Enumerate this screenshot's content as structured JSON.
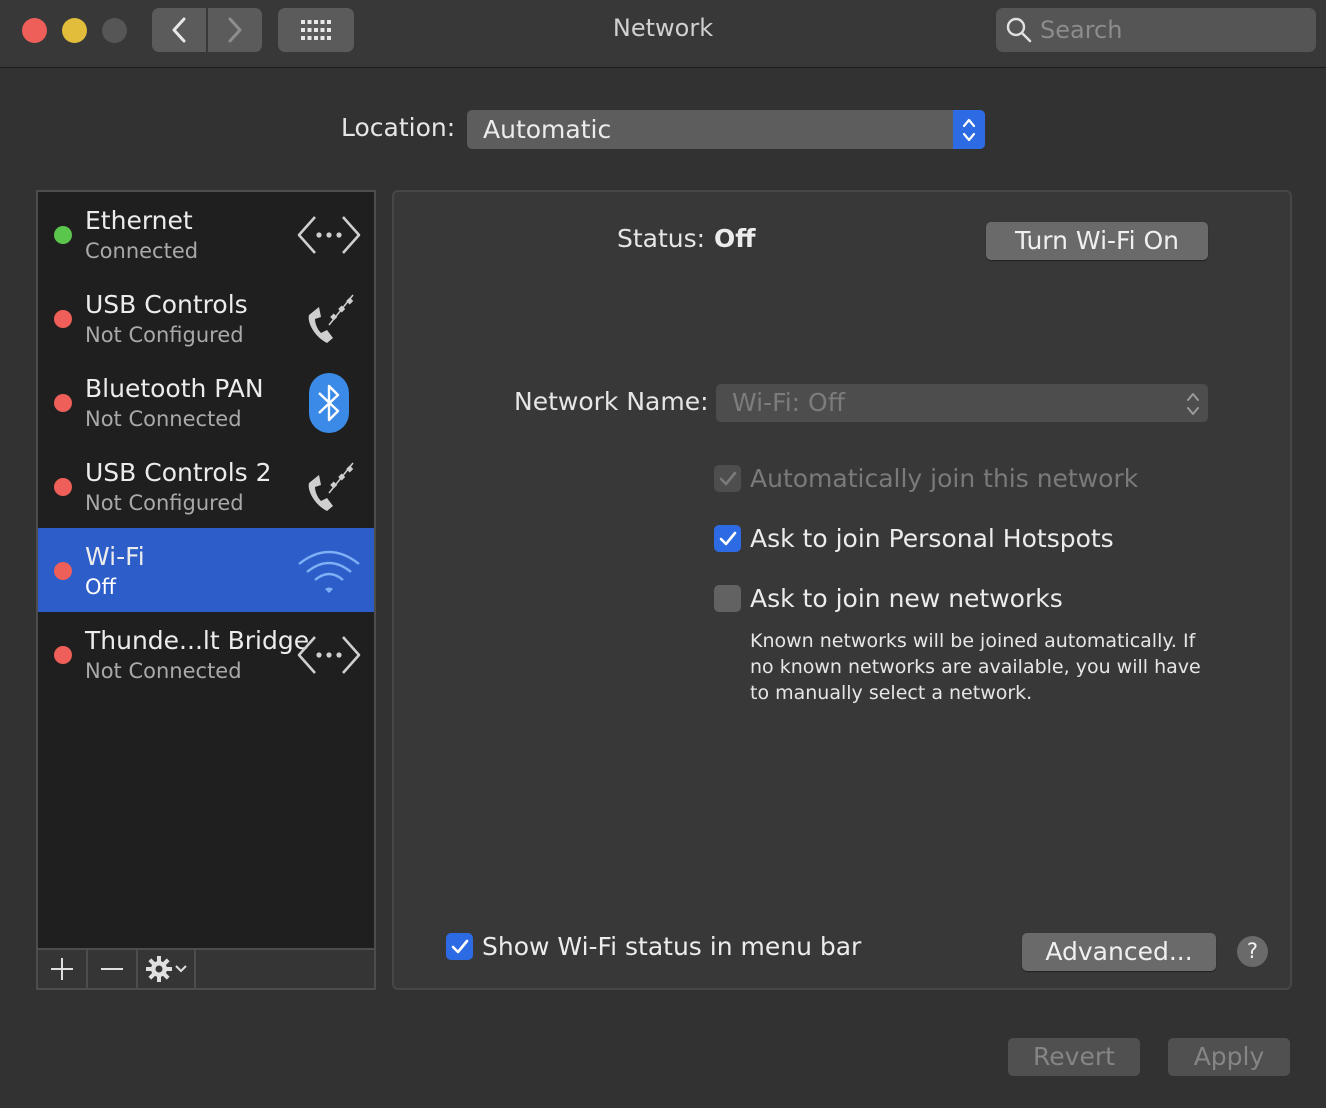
{
  "window": {
    "title": "Network",
    "search_placeholder": "Search"
  },
  "location": {
    "label": "Location:",
    "value": "Automatic"
  },
  "services": [
    {
      "name": "Ethernet",
      "status": "Connected",
      "dot_color": "#5bc64c",
      "icon": "ethernet-arrows-icon"
    },
    {
      "name": "USB Controls",
      "status": "Not Configured",
      "dot_color": "#ed5f58",
      "icon": "phone-modem-icon"
    },
    {
      "name": "Bluetooth PAN",
      "status": "Not Connected",
      "dot_color": "#ed5f58",
      "icon": "bluetooth-icon"
    },
    {
      "name": "USB Controls 2",
      "status": "Not Configured",
      "dot_color": "#ed5f58",
      "icon": "phone-modem-icon"
    },
    {
      "name": "Wi-Fi",
      "status": "Off",
      "dot_color": "#ed5f58",
      "icon": "wifi-icon",
      "selected": true
    },
    {
      "name": "Thunde...lt Bridge",
      "status": "Not Connected",
      "dot_color": "#ed5f58",
      "icon": "ethernet-arrows-icon"
    }
  ],
  "detail": {
    "status_label": "Status:",
    "status_value": "Off",
    "turn_on_button": "Turn Wi-Fi On",
    "network_name_label": "Network Name:",
    "network_name_value": "Wi-Fi: Off",
    "auto_join_label": "Automatically join this network",
    "auto_join_checked": true,
    "auto_join_enabled": false,
    "hotspots_label": "Ask to join Personal Hotspots",
    "hotspots_checked": true,
    "new_networks_label": "Ask to join new networks",
    "new_networks_checked": false,
    "new_networks_note": "Known networks will be joined automatically. If no known networks are available, you will have to manually select a network.",
    "menubar_label": "Show Wi-Fi status in menu bar",
    "menubar_checked": true,
    "advanced_button": "Advanced...",
    "help_button": "?"
  },
  "footer": {
    "revert_button": "Revert",
    "apply_button": "Apply"
  },
  "colors": {
    "accent": "#2d6be4",
    "selection": "#2c5dc9",
    "status_red": "#ed5f58",
    "status_green": "#5bc64c"
  }
}
